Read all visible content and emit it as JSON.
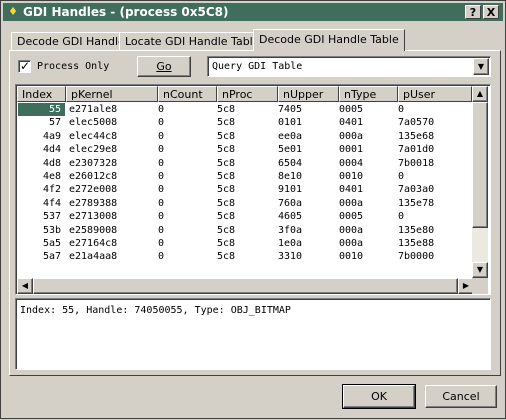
{
  "window": {
    "title": "GDI Handles - (process 0x5C8)",
    "help_label": "?",
    "close_label": "X"
  },
  "tabs": [
    "Decode GDI Handle",
    "Locate GDI Handle Table",
    "Decode GDI Handle Table"
  ],
  "active_tab": 2,
  "controls": {
    "process_only_label": "Process Only",
    "process_only_checked": true,
    "go_label": "Go",
    "query_value": "Query GDI Table"
  },
  "table": {
    "columns": [
      "Index",
      "pKernel",
      "nCount",
      "nProc",
      "nUpper",
      "nType",
      "pUser"
    ],
    "rows": [
      [
        "55",
        "e271ale8",
        "0",
        "5c8",
        "7405",
        "0005",
        "0"
      ],
      [
        "57",
        "elec5008",
        "0",
        "5c8",
        "0101",
        "0401",
        "7a0570"
      ],
      [
        "4a9",
        "elec44c8",
        "0",
        "5c8",
        "ee0a",
        "000a",
        "135e68"
      ],
      [
        "4d4",
        "elec29e8",
        "0",
        "5c8",
        "5e01",
        "0001",
        "7a01d0"
      ],
      [
        "4d8",
        "e2307328",
        "0",
        "5c8",
        "6504",
        "0004",
        "7b0018"
      ],
      [
        "4e8",
        "e26012c8",
        "0",
        "5c8",
        "8e10",
        "0010",
        "0"
      ],
      [
        "4f2",
        "e272e008",
        "0",
        "5c8",
        "9101",
        "0401",
        "7a03a0"
      ],
      [
        "4f4",
        "e2789388",
        "0",
        "5c8",
        "760a",
        "000a",
        "135e78"
      ],
      [
        "537",
        "e2713008",
        "0",
        "5c8",
        "4605",
        "0005",
        "0"
      ],
      [
        "53b",
        "e2589008",
        "0",
        "5c8",
        "3f0a",
        "000a",
        "135e80"
      ],
      [
        "5a5",
        "e27164c8",
        "0",
        "5c8",
        "1e0a",
        "000a",
        "135e88"
      ],
      [
        "5a7",
        "e21a4aa8",
        "0",
        "5c8",
        "3310",
        "0010",
        "7b0000"
      ]
    ],
    "selected_row": 0
  },
  "details": "Index: 55, Handle: 74050055, Type: OBJ_BITMAP",
  "buttons": {
    "ok": "OK",
    "cancel": "Cancel"
  },
  "colors": {
    "title_bar": "#3f6f5c",
    "selection": "#3f6f5c",
    "face": "#d4d0c8"
  },
  "icons": {
    "app": "gdi-app-icon",
    "scroll_up": "arrow-up-icon",
    "scroll_down": "arrow-down-icon",
    "scroll_left": "arrow-left-icon",
    "scroll_right": "arrow-right-icon",
    "dropdown": "chevron-down-icon"
  }
}
